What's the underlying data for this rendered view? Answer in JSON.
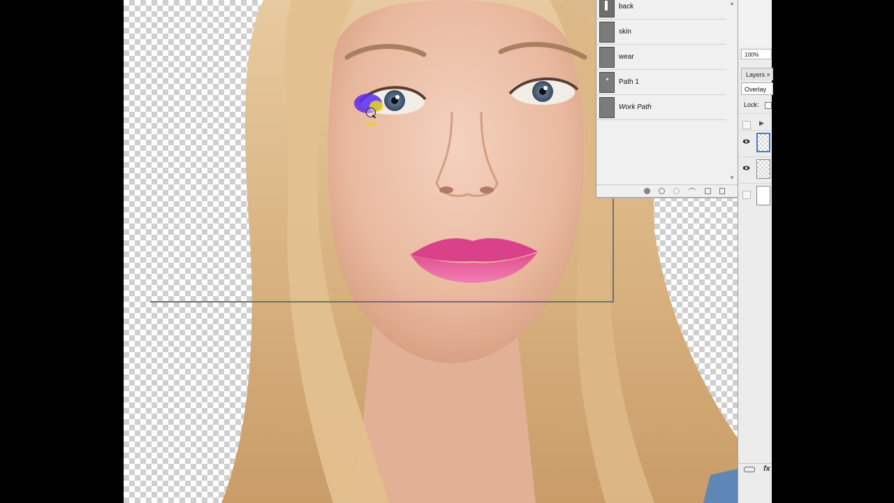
{
  "paths_panel": {
    "items": [
      {
        "label": "back",
        "italic": false,
        "thumb": "path-mark"
      },
      {
        "label": "skin",
        "italic": false,
        "thumb": "plain"
      },
      {
        "label": "wear",
        "italic": false,
        "thumb": "plain"
      },
      {
        "label": "Path 1",
        "italic": false,
        "thumb": "dot"
      },
      {
        "label": "Work Path",
        "italic": true,
        "thumb": "plain"
      }
    ],
    "footer_icons": [
      "fill-path-icon",
      "stroke-path-icon",
      "load-selection-icon",
      "make-work-path-icon",
      "new-path-icon",
      "delete-path-icon"
    ]
  },
  "layers_panel": {
    "zoom": "100%",
    "tab_label": "Layers ×",
    "blend_mode": "Overlay",
    "lock_label": "Lock:",
    "fx_label": "fx"
  },
  "colors": {
    "selection_blue": "#3d7bd6",
    "brush_purple": "#5a2cf0",
    "brush_yellow": "#e9d321",
    "lip_pink": "#e8579a"
  }
}
